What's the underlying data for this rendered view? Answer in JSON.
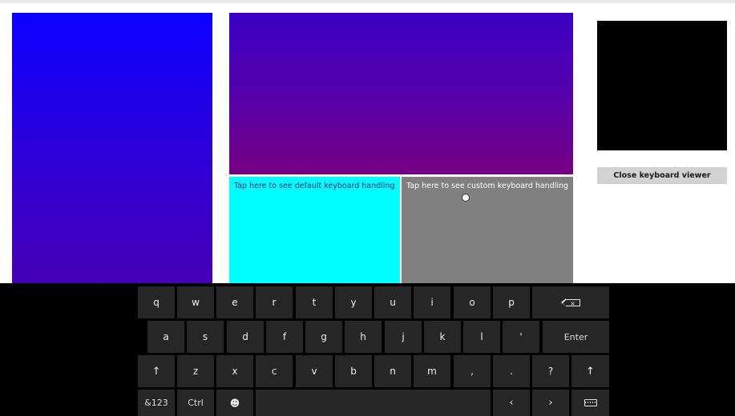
{
  "panels": {
    "default_caption": "Tap here to see default keyboard handling",
    "custom_caption": "Tap here to see custom keyboard handling"
  },
  "viewer": {
    "close_label": "Close keyboard viewer"
  },
  "keyboard": {
    "row1": [
      "q",
      "w",
      "e",
      "r",
      "t",
      "y",
      "u",
      "i",
      "o",
      "p"
    ],
    "row2": [
      "a",
      "s",
      "d",
      "f",
      "g",
      "h",
      "j",
      "k",
      "l",
      "'"
    ],
    "row3": [
      "↑",
      "z",
      "x",
      "c",
      "v",
      "b",
      "n",
      "m",
      ",",
      ".",
      "?",
      "↑"
    ],
    "enter_label": "Enter",
    "sym_label": "&123",
    "ctrl_label": "Ctrl",
    "emoji_glyph": "☻",
    "left_arrow": "‹",
    "right_arrow": "›",
    "backspace_icon": "backspace-icon",
    "keyboard_icon": "keyboard-icon"
  },
  "colors": {
    "cyan_panel": "#00ffff",
    "gray_panel": "#808080",
    "key_bg": "#262626",
    "keyboard_bg": "#000000"
  }
}
